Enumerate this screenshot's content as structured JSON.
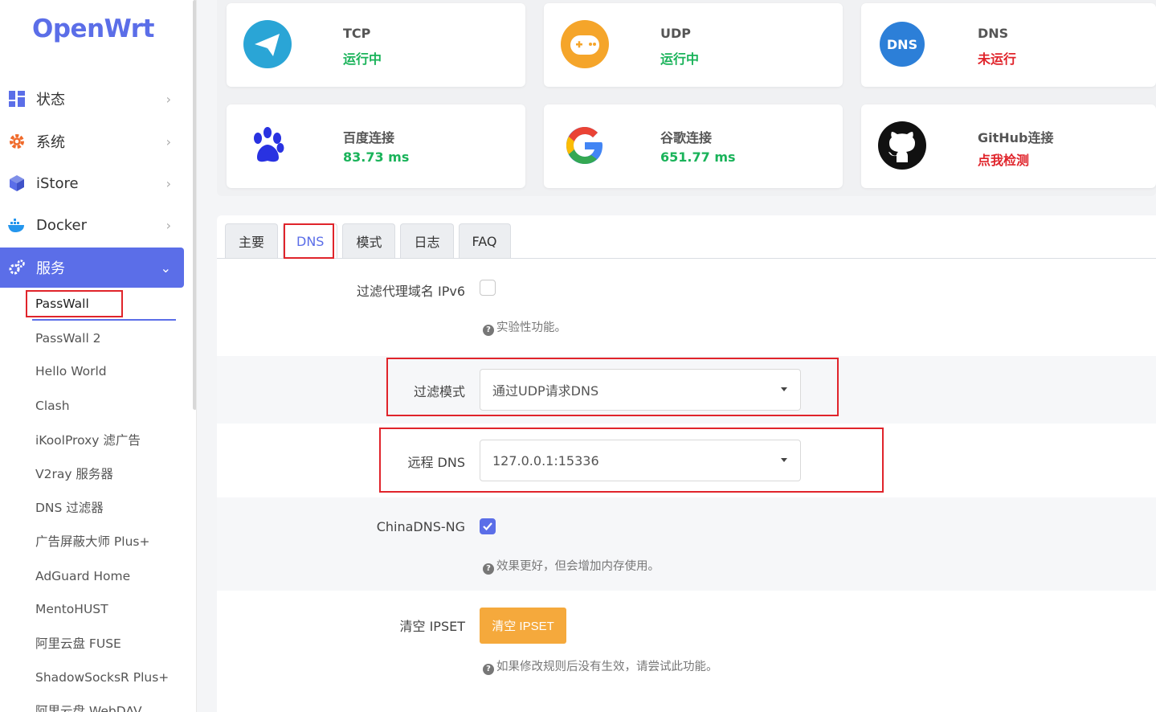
{
  "app": {
    "logo": "OpenWrt"
  },
  "sidebar": {
    "items": [
      {
        "label": "状态",
        "icon": "dashboard-icon"
      },
      {
        "label": "系统",
        "icon": "gear-icon"
      },
      {
        "label": "iStore",
        "icon": "cube-icon"
      },
      {
        "label": "Docker",
        "icon": "docker-icon"
      },
      {
        "label": "服务",
        "icon": "cogs-icon"
      }
    ],
    "sub_items": [
      "PassWall",
      "PassWall 2",
      "Hello World",
      "Clash",
      "iKoolProxy 滤广告",
      "V2ray 服务器",
      "DNS 过滤器",
      "广告屏蔽大师 Plus+",
      "AdGuard Home",
      "MentoHUST",
      "阿里云盘 FUSE",
      "ShadowSocksR Plus+",
      "阿里云盘 WebDAV"
    ]
  },
  "status_cards": [
    {
      "title": "TCP",
      "value": "运行中",
      "icon": "paper-plane-icon",
      "state": "ok"
    },
    {
      "title": "UDP",
      "value": "运行中",
      "icon": "gamepad-icon",
      "state": "ok"
    },
    {
      "title": "DNS",
      "value": "未运行",
      "icon": "dns-icon",
      "icon_text": "DNS",
      "state": "stopped"
    },
    {
      "title": "百度连接",
      "value": "83.73 ms",
      "icon": "baidu-paw-icon",
      "state": "ok"
    },
    {
      "title": "谷歌连接",
      "value": "651.77 ms",
      "icon": "google-icon",
      "state": "ok"
    },
    {
      "title": "GitHub连接",
      "value": "点我检测",
      "icon": "github-icon",
      "state": "action"
    }
  ],
  "tabs": [
    "主要",
    "DNS",
    "模式",
    "日志",
    "FAQ"
  ],
  "form": {
    "ipv6_label": "过滤代理域名 IPv6",
    "ipv6_hint": "实验性功能。",
    "filter_mode_label": "过滤模式",
    "filter_mode_value": "通过UDP请求DNS",
    "remote_dns_label": "远程 DNS",
    "remote_dns_value": "127.0.0.1:15336",
    "chinadns_label": "ChinaDNS-NG",
    "chinadns_hint": "效果更好，但会增加内存使用。",
    "ipset_label": "清空 IPSET",
    "ipset_button": "清空 IPSET",
    "ipset_hint": "如果修改规则后没有生效，请尝试此功能。"
  },
  "colors": {
    "accent": "#5b6ee8",
    "ok": "#1ab35a",
    "error": "#e0242b",
    "warning_button": "#f5a93c",
    "highlight_box": "#e0242b"
  }
}
